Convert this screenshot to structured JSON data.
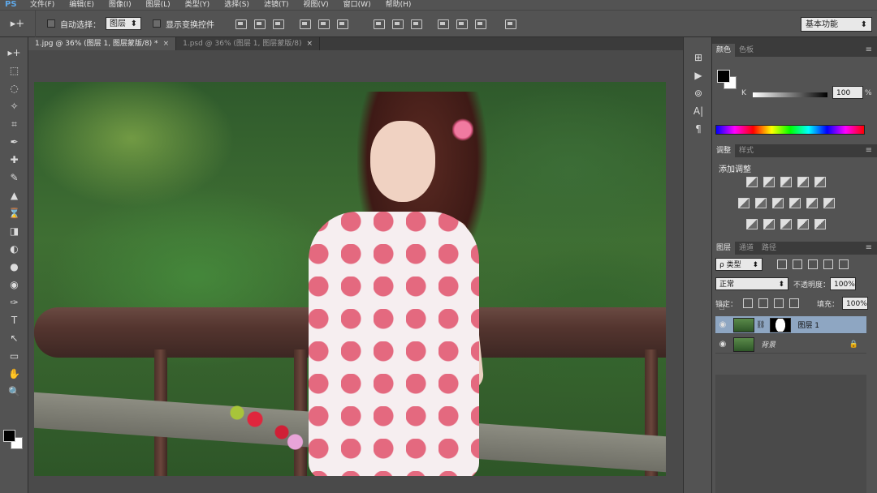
{
  "menu": {
    "logo": "PS",
    "items": [
      "文件(F)",
      "编辑(E)",
      "图像(I)",
      "图层(L)",
      "类型(Y)",
      "选择(S)",
      "滤镜(T)",
      "视图(V)",
      "窗口(W)",
      "帮助(H)"
    ]
  },
  "options": {
    "tool_icon": "move-tool",
    "auto_select_label": "自动选择：",
    "auto_select_value": "图层",
    "show_transform_label": "显示变换控件",
    "workspace": "基本功能"
  },
  "tabs": [
    {
      "label": "1.jpg @ 36% (图层 1, 图层蒙版/8) *",
      "close": "×"
    },
    {
      "label": "1.psd @ 36% (图层 1, 图层蒙版/8)",
      "close": "×"
    }
  ],
  "toolbox": {
    "tools": [
      "▸+",
      "⬚",
      "◌",
      "✧",
      "⌗",
      "✒",
      "✚",
      "✎",
      "▲",
      "⌛",
      "◨",
      "◐",
      "●",
      "◉",
      "✑",
      "T",
      "↖",
      "▭",
      "✋",
      "🔍"
    ]
  },
  "color_panel": {
    "tabs": [
      "颜色",
      "色板"
    ],
    "channel": "K",
    "value": "100",
    "unit": "%",
    "k_level_percent": 100
  },
  "adjust_panel": {
    "tabs": [
      "调整",
      "样式"
    ],
    "title": "添加调整"
  },
  "layers_panel": {
    "tabs": [
      "图层",
      "通道",
      "路径"
    ],
    "filter": "ρ 类型",
    "blend_mode": "正常",
    "opacity_label": "不透明度：",
    "opacity_value": "100%",
    "lock_label": "锁定：",
    "fill_label": "填充：",
    "fill_value": "100%",
    "layers": [
      {
        "name": "图层 1",
        "selected": true
      },
      {
        "name": "背景",
        "selected": false
      }
    ]
  },
  "dock": {
    "buttons": [
      "⊞",
      "▶",
      "⊚",
      "A|",
      "¶"
    ]
  },
  "colors": {
    "ui_dark": "#535353",
    "selected_layer": "#8ea6c2"
  }
}
